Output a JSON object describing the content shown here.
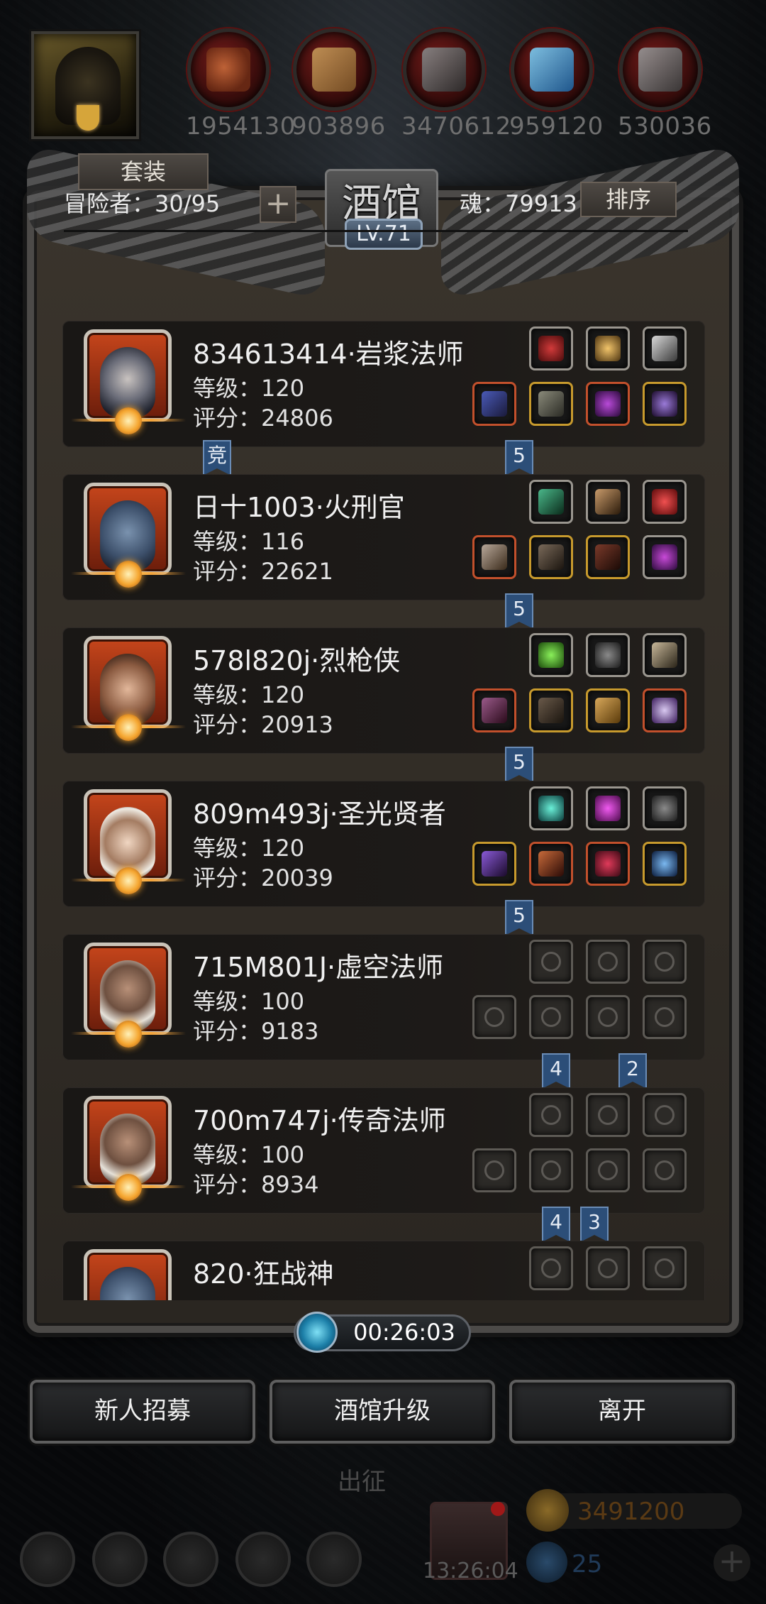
{
  "resources": [
    {
      "icon": "meat-icon",
      "value": "1954130"
    },
    {
      "icon": "wood-icon",
      "value": "903896"
    },
    {
      "icon": "ore-icon",
      "value": "3470612"
    },
    {
      "icon": "crystal-icon",
      "value": "959120"
    },
    {
      "icon": "iron-icon",
      "value": "530036"
    }
  ],
  "tavern": {
    "title": "酒馆",
    "level": "LV.71",
    "suit_label": "套装",
    "adventurers": "冒险者：30/95",
    "plus_label": "+",
    "soul": "魂：79913",
    "sort_label": "排序"
  },
  "heroes": [
    {
      "name": "834613414·岩浆法师",
      "level": "等级：120",
      "score": "评分：24806",
      "equip_top": [
        "q-gray",
        "q-gray",
        "q-gray"
      ],
      "equip_bottom": [
        "q-red",
        "q-gold",
        "q-red",
        "q-gold"
      ],
      "badges": [
        "竞",
        "5"
      ]
    },
    {
      "name": "日十1003·火刑官",
      "level": "等级：116",
      "score": "评分：22621",
      "equip_top": [
        "q-gray",
        "q-gray",
        "q-gray"
      ],
      "equip_bottom": [
        "q-red",
        "q-gold",
        "q-gold",
        "q-gray"
      ],
      "badges": [
        "5"
      ]
    },
    {
      "name": "578l820j·烈枪侠",
      "level": "等级：120",
      "score": "评分：20913",
      "equip_top": [
        "q-gray",
        "q-gray",
        "q-gray"
      ],
      "equip_bottom": [
        "q-red",
        "q-gold",
        "q-gold",
        "q-red"
      ],
      "badges": [
        "5"
      ]
    },
    {
      "name": "809m493j·圣光贤者",
      "level": "等级：120",
      "score": "评分：20039",
      "equip_top": [
        "q-gray",
        "q-gray",
        "q-gray"
      ],
      "equip_bottom": [
        "q-gold",
        "q-red",
        "q-red",
        "q-gold"
      ],
      "badges": [
        "5"
      ]
    },
    {
      "name": "715M801J·虚空法师",
      "level": "等级：100",
      "score": "评分：9183",
      "equip_top": [
        "empty",
        "empty",
        "empty"
      ],
      "equip_bottom": [
        "empty",
        "empty",
        "empty",
        "empty"
      ],
      "badges": [
        "4",
        "2"
      ]
    },
    {
      "name": "700m747j·传奇法师",
      "level": "等级：100",
      "score": "评分：8934",
      "equip_top": [
        "empty",
        "empty",
        "empty"
      ],
      "equip_bottom": [
        "empty",
        "empty",
        "empty",
        "empty"
      ],
      "badges": [
        "4",
        "3"
      ]
    },
    {
      "name": "820·狂战神",
      "level": "",
      "score": "",
      "equip_top": [
        "empty",
        "empty",
        "empty"
      ],
      "equip_bottom": [],
      "badges": []
    }
  ],
  "timer": "00:26:03",
  "buttons": {
    "recruit": "新人招募",
    "upgrade": "酒馆升级",
    "leave": "离开"
  },
  "background_ui": {
    "expedition": "出征",
    "clock": "13:26:04",
    "gold": "3491200",
    "gems": "25"
  }
}
